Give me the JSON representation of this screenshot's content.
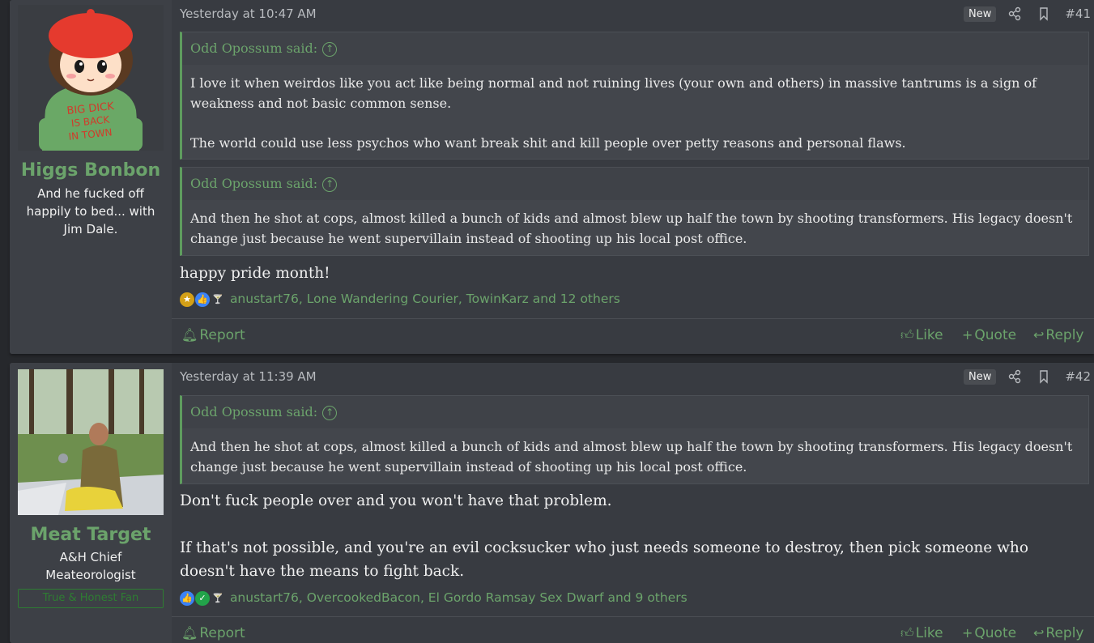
{
  "posts": [
    {
      "user": {
        "name": "Higgs Bonbon",
        "title_lines": [
          "And he fucked off",
          "happily to bed... with",
          "Jim Dale."
        ],
        "avatar_text": [
          "BIG DICK",
          "IS BACK",
          "IN TOWN"
        ]
      },
      "timestamp": "Yesterday at 10:47 AM",
      "badge": "New",
      "number": "#41",
      "quotes": [
        {
          "author": "Odd Opossum said:",
          "paragraphs": [
            "I love it when weirdos like you act like being normal and not ruining lives (your own and others) in massive tantrums is a sign of weakness and not basic common sense.",
            "The world could use less psychos who want break shit and kill people over petty reasons and personal flaws."
          ]
        },
        {
          "author": "Odd Opossum said:",
          "paragraphs": [
            "And then he shot at cops, almost killed a bunch of kids and almost blew up half the town by shooting transformers. His legacy doesn't change just because he went supervillain instead of shooting up his local post office."
          ]
        }
      ],
      "message": [
        "happy pride month!"
      ],
      "reactions_text": "anustart76, Lone Wandering Courier, TowinKarz and 12 others",
      "actions": {
        "report": "Report",
        "like": "Like",
        "quote": "Quote",
        "reply": "Reply"
      }
    },
    {
      "user": {
        "name": "Meat Target",
        "title_lines": [
          "A&H Chief",
          "Meateorologist"
        ],
        "banner": "True & Honest Fan"
      },
      "timestamp": "Yesterday at 11:39 AM",
      "badge": "New",
      "number": "#42",
      "quotes": [
        {
          "author": "Odd Opossum said:",
          "paragraphs": [
            "And then he shot at cops, almost killed a bunch of kids and almost blew up half the town by shooting transformers. His legacy doesn't change just because he went supervillain instead of shooting up his local post office."
          ]
        }
      ],
      "message": [
        "Don't fuck people over and you won't have that problem.",
        "If that's not possible, and you're an evil cocksucker who just needs someone to destroy, then pick someone who doesn't have the means to fight back."
      ],
      "reactions_text": "anustart76, OvercookedBacon, El Gordo Ramsay Sex Dwarf and 9 others",
      "actions": {
        "report": "Report",
        "like": "Like",
        "quote": "Quote",
        "reply": "Reply"
      }
    }
  ],
  "colors": {
    "accent": "#6ba36b",
    "background": "#26282c",
    "post_bg": "#383b41",
    "userpane_bg": "#3d4046"
  }
}
